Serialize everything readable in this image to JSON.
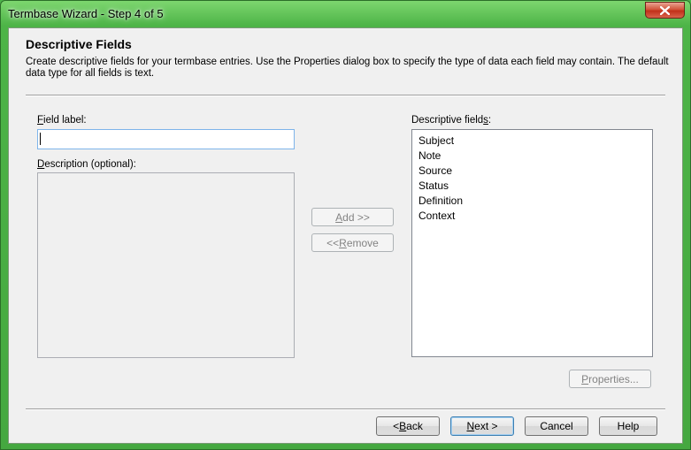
{
  "window": {
    "title": "Termbase Wizard - Step 4 of 5"
  },
  "header": {
    "title": "Descriptive Fields",
    "description": "Create descriptive fields for your termbase entries. Use the Properties dialog box to specify the type of data each field may contain. The default data type for all fields is text."
  },
  "form": {
    "field_label": {
      "mnemonic": "F",
      "rest": "ield label:"
    },
    "field_value": "",
    "description_label": {
      "mnemonic": "D",
      "rest": "escription (optional):"
    }
  },
  "actions": {
    "add": {
      "mnemonic": "A",
      "rest": "dd >>"
    },
    "remove": {
      "pre": "<< ",
      "mnemonic": "R",
      "rest": "emove"
    }
  },
  "descriptive_fields": {
    "label": {
      "pre": "Descriptive field",
      "mnemonic": "s",
      "rest": ":"
    },
    "items": [
      "Subject",
      "Note",
      "Source",
      "Status",
      "Definition",
      "Context"
    ]
  },
  "properties_button": {
    "mnemonic": "P",
    "rest": "roperties..."
  },
  "footer": {
    "back": {
      "pre": "< ",
      "mnemonic": "B",
      "rest": "ack"
    },
    "next": {
      "mnemonic": "N",
      "rest": "ext >"
    },
    "cancel": "Cancel",
    "help": "Help"
  },
  "colors": {
    "title_bar": "#4db447",
    "close_button": "#c2301a",
    "client_bg": "#f0f0f0"
  }
}
